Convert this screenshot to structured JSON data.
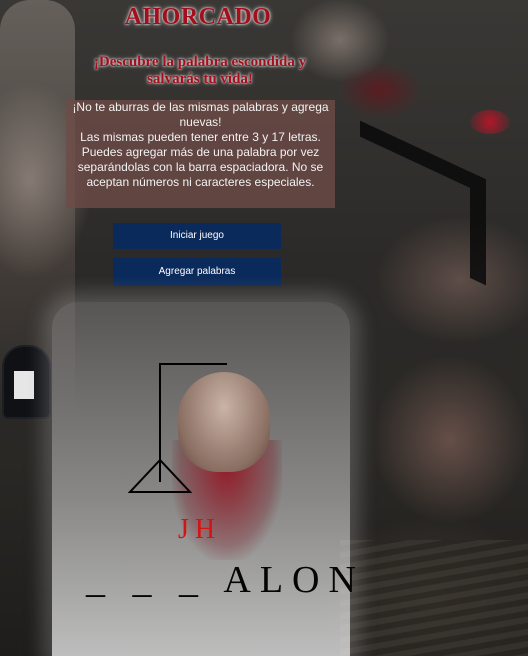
{
  "header": {
    "title": "AHORCADO",
    "subtitle": "¡Descubre la palabra escondida y salvarás tu vida!"
  },
  "info": {
    "line1": "¡No te aburras de las mismas palabras y agrega nuevas!",
    "line2": "Las mismas pueden tener entre 3 y 17 letras. Puedes agregar más de una palabra por vez separándolas con la barra espaciadora. No se aceptan números ni caracteres especiales."
  },
  "buttons": {
    "start_label": "Iniciar juego",
    "add_label": "Agregar palabras"
  },
  "game": {
    "wrong_letters": "JH",
    "word_display": "_ _ _ ALON"
  },
  "colors": {
    "title": "#a30f1c",
    "button_bg": "#0b2a5c",
    "wrong_letters": "#d41414",
    "info_box": "#6e4b48"
  }
}
